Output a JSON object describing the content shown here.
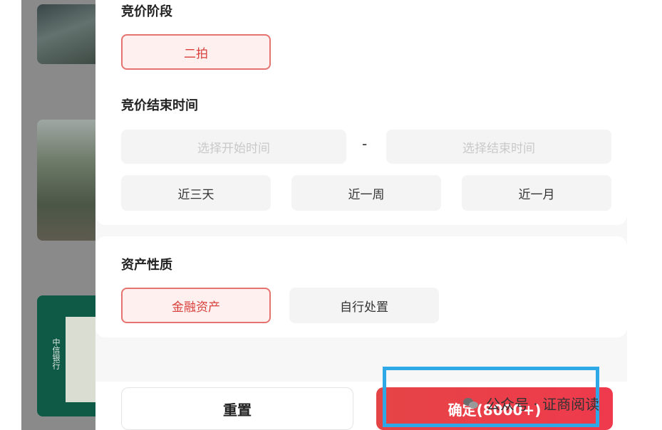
{
  "bidding_stage": {
    "title": "竞价阶段",
    "options": [
      {
        "label": "二拍",
        "selected": true
      }
    ]
  },
  "bid_end_time": {
    "title": "竞价结束时间",
    "start_placeholder": "选择开始时间",
    "separator": "-",
    "end_placeholder": "选择结束时间",
    "quick_ranges": [
      {
        "label": "近三天"
      },
      {
        "label": "近一周"
      },
      {
        "label": "近一月"
      }
    ]
  },
  "asset_nature": {
    "title": "资产性质",
    "options": [
      {
        "label": "金融资产",
        "selected": true
      },
      {
        "label": "自行处置",
        "selected": false
      }
    ]
  },
  "footer": {
    "reset_label": "重置",
    "confirm_label": "确定(8000+)"
  },
  "background_list": {
    "thumb_logo_text": "中信银行"
  },
  "watermark": {
    "text": "公众号 · 证商阅读"
  },
  "colors": {
    "accent": "#d9403b",
    "confirm_bg": "#e54446",
    "highlight_box": "#2ea8e6"
  }
}
